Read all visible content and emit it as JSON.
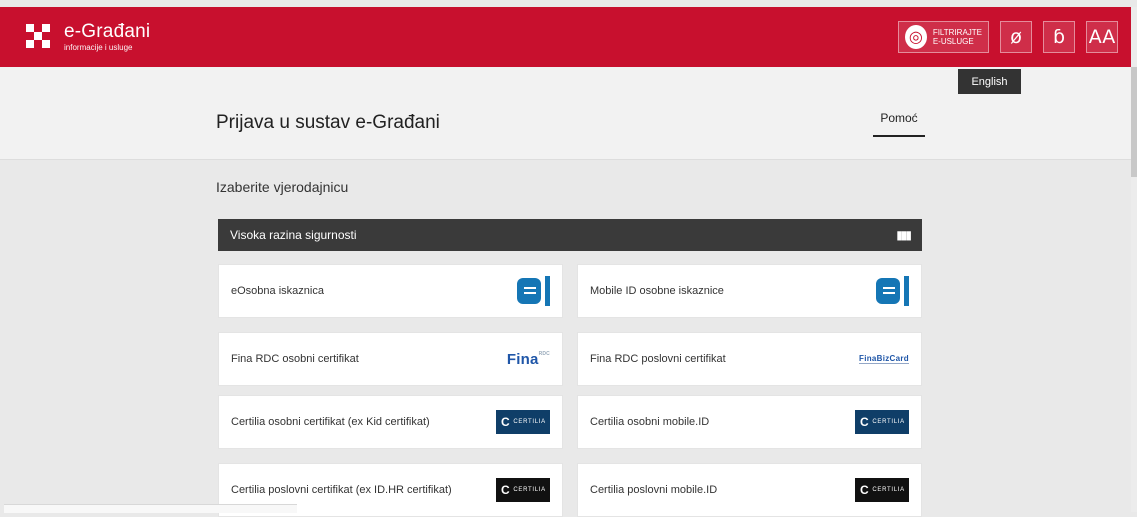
{
  "header": {
    "brand_title": "e-Građani",
    "brand_subtitle": "informacije i usluge",
    "filter_label_line1": "FILTRIRAJTE",
    "filter_label_line2": "E-USLUGE",
    "icons": [
      "eye-slash-icon",
      "font-icon",
      "text-size-icon"
    ],
    "font_tool_glyph": "ɓ",
    "text_size_label": "AA",
    "language_label": "English",
    "accent_color": "#c8102e"
  },
  "page": {
    "title": "Prijava u sustav e-Građani",
    "help_label": "Pomoć",
    "section_title": "Izaberite vjerodajnicu",
    "security_level_label": "Visoka razina sigurnosti"
  },
  "credentials": [
    {
      "label": "eOsobna iskaznica",
      "logo": "eoi"
    },
    {
      "label": "Mobile ID osobne iskaznice",
      "logo": "eoi"
    },
    {
      "label": "Fina RDC osobni certifikat",
      "logo": "fina"
    },
    {
      "label": "Fina RDC poslovni certifikat",
      "logo": "fina-business"
    },
    {
      "label": "Certilia osobni certifikat (ex Kid certifikat)",
      "logo": "certilia-blue"
    },
    {
      "label": "Certilia osobni mobile.ID",
      "logo": "certilia-blue"
    },
    {
      "label": "Certilia poslovni certifikat (ex ID.HR certifikat)",
      "logo": "certilia-black"
    },
    {
      "label": "Certilia poslovni mobile.ID",
      "logo": "certilia-black"
    }
  ],
  "logo_text": {
    "fina": "Fina",
    "fina_small": "RDC",
    "fina_business": "FinaBizCard",
    "certilia": "CERTILIA"
  }
}
